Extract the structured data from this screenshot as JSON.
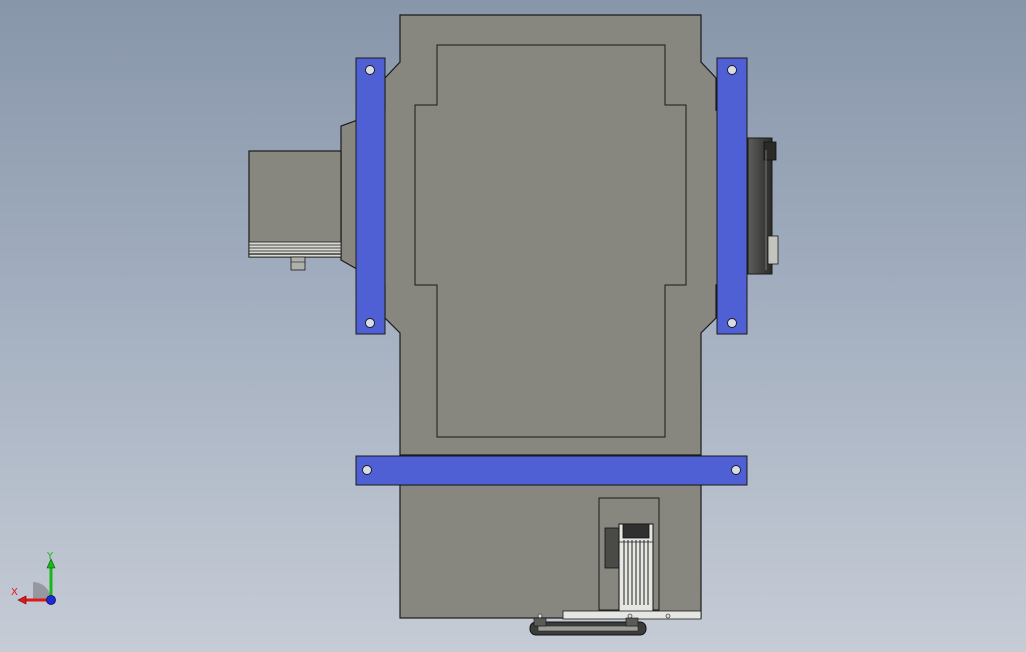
{
  "viewport": {
    "background_top": "#8896aa",
    "background_bottom": "#c6ccd6"
  },
  "model": {
    "housing_color": "#878780",
    "bracket_color": "#4e60d3",
    "edge_color": "#1a1a1a",
    "parts": [
      "gearbox-housing",
      "left-mounting-bracket",
      "right-mounting-bracket",
      "bottom-mounting-bracket",
      "input-motor",
      "output-flange",
      "servo-motor",
      "timing-belt-pulley"
    ]
  },
  "triad": {
    "x_label": "X",
    "y_label": "Y",
    "x_color": "#e01818",
    "y_color": "#17b817",
    "z_color": "#1c2bd8"
  }
}
